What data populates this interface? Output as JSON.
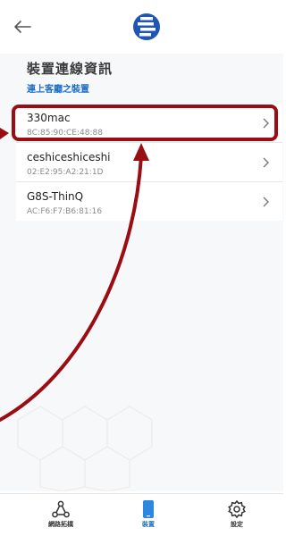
{
  "page": {
    "title": "裝置連線資訊",
    "section": "連上客廳之裝置"
  },
  "devices": [
    {
      "name": "330mac",
      "mac": "8C:85:90:CE:48:88"
    },
    {
      "name": "ceshiceshiceshi",
      "mac": "02:E2:95:A2:21:1D"
    },
    {
      "name": "G8S-ThinQ",
      "mac": "AC:F6:F7:B6:81:16"
    }
  ],
  "nav": {
    "items": [
      {
        "label": "網路拓樸",
        "icon": "network-topology-icon"
      },
      {
        "label": "裝置",
        "icon": "device-phone-icon"
      },
      {
        "label": "設定",
        "icon": "gear-icon"
      }
    ]
  },
  "colors": {
    "accent": "#1e6fc6",
    "annotation": "#9a0d12"
  }
}
